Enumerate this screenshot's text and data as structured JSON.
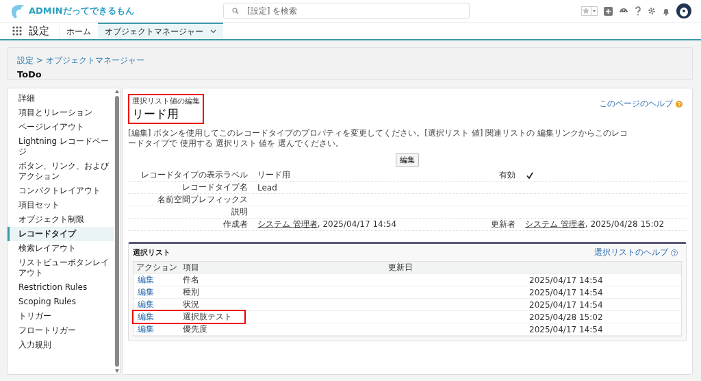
{
  "header": {
    "logo_text": "ADMINだってできるもん",
    "search": {
      "placeholder": "[設定] を検索"
    }
  },
  "nav": {
    "app_name": "設定",
    "tabs": [
      {
        "label": "ホーム",
        "selected": false
      },
      {
        "label": "オブジェクトマネージャー",
        "selected": true
      }
    ]
  },
  "breadcrumb": {
    "path": "設定 > オブジェクトマネージャー",
    "title": "ToDo"
  },
  "sidebar": {
    "items": [
      {
        "label": "詳細",
        "selected": false
      },
      {
        "label": "項目とリレーション",
        "selected": false
      },
      {
        "label": "ページレイアウト",
        "selected": false
      },
      {
        "label": "Lightning レコードページ",
        "selected": false
      },
      {
        "label": "ボタン、リンク、およびアクション",
        "selected": false
      },
      {
        "label": "コンパクトレイアウト",
        "selected": false
      },
      {
        "label": "項目セット",
        "selected": false
      },
      {
        "label": "オブジェクト制限",
        "selected": false
      },
      {
        "label": "レコードタイプ",
        "selected": true
      },
      {
        "label": "検索レイアウト",
        "selected": false
      },
      {
        "label": "リストビューボタンレイアウト",
        "selected": false
      },
      {
        "label": "Restriction Rules",
        "selected": false
      },
      {
        "label": "Scoping Rules",
        "selected": false
      },
      {
        "label": "トリガー",
        "selected": false
      },
      {
        "label": "フロートリガー",
        "selected": false
      },
      {
        "label": "入力規則",
        "selected": false
      }
    ]
  },
  "content": {
    "subtitle": "選択リスト値の編集",
    "title": "リード用",
    "title_highlighted": true,
    "help_link": "このページのヘルプ",
    "description": "[編集] ボタンを使用してこのレコードタイプのプロパティを変更してください。[選択リスト 値] 関連リストの 編集リンクからこのレコードタイプで 使用する 選択リスト 値を 選んでください。",
    "edit_button": "編集",
    "details": [
      [
        {
          "label": "レコードタイプの表示ラベル",
          "value": "リード用"
        },
        {
          "label": "有効",
          "checked": true
        }
      ],
      [
        {
          "label": "レコードタイプ名",
          "value": "Lead"
        }
      ],
      [
        {
          "label": "名前空間プレフィックス"
        }
      ],
      [
        {
          "label": "説明"
        }
      ],
      [
        {
          "label": "作成者",
          "user": "システム 管理者",
          "value": ", 2025/04/17 14:54"
        },
        {
          "label": "更新者",
          "user": "システム 管理者",
          "value": ", 2025/04/28 15:02"
        }
      ]
    ]
  },
  "picklist": {
    "title": "選択リスト",
    "help_link": "選択リストのヘルプ",
    "columns": [
      "アクション",
      "項目",
      "更新日"
    ],
    "rows": [
      {
        "action": "編集",
        "field": "件名",
        "updated": "2025/04/17 14:54",
        "highlighted": false
      },
      {
        "action": "編集",
        "field": "種別",
        "updated": "2025/04/17 14:54",
        "highlighted": false
      },
      {
        "action": "編集",
        "field": "状況",
        "updated": "2025/04/17 14:54",
        "highlighted": false
      },
      {
        "action": "編集",
        "field": "選択肢テスト",
        "updated": "2025/04/28 15:02",
        "highlighted": true
      },
      {
        "action": "編集",
        "field": "優先度",
        "updated": "2025/04/17 14:54",
        "highlighted": false
      }
    ]
  }
}
